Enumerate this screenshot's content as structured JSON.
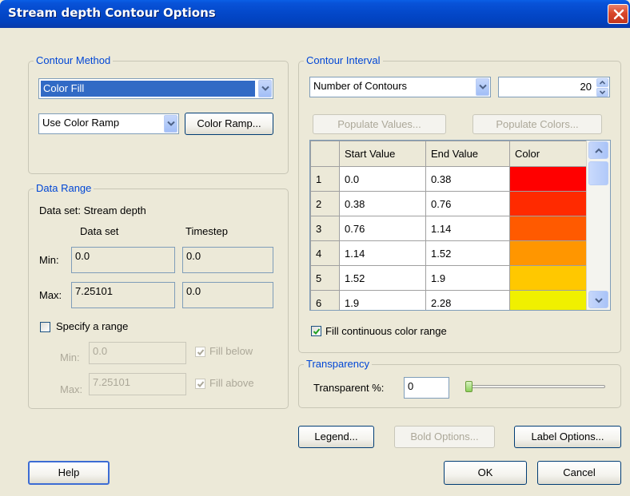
{
  "window": {
    "title": "Stream depth Contour Options"
  },
  "contour_method": {
    "legend": "Contour Method",
    "method_value": "Color Fill",
    "ramp_value": "Use Color Ramp",
    "color_ramp_button": "Color Ramp..."
  },
  "data_range": {
    "legend": "Data Range",
    "data_set_label": "Data set:  Stream depth",
    "col_dataset": "Data set",
    "col_timestep": "Timestep",
    "min_label": "Min:",
    "max_label": "Max:",
    "min_dataset": "0.0",
    "min_timestep": "0.0",
    "max_dataset": "7.25101",
    "max_timestep": "0.0",
    "specify_range_label": "Specify a range",
    "specify_range_checked": false,
    "range_min_label": "Min:",
    "range_max_label": "Max:",
    "range_min_value": "0.0",
    "range_max_value": "7.25101",
    "fill_below_label": "Fill below",
    "fill_above_label": "Fill above"
  },
  "contour_interval": {
    "legend": "Contour Interval",
    "mode_value": "Number of Contours",
    "count_value": "20",
    "populate_values_button": "Populate Values...",
    "populate_colors_button": "Populate Colors...",
    "columns": [
      "",
      "Start Value",
      "End Value",
      "Color"
    ],
    "rows": [
      {
        "index": "1",
        "start": "0.0",
        "end": "0.38",
        "color": "#ff0000"
      },
      {
        "index": "2",
        "start": "0.38",
        "end": "0.76",
        "color": "#ff2a00"
      },
      {
        "index": "3",
        "start": "0.76",
        "end": "1.14",
        "color": "#ff5a00"
      },
      {
        "index": "4",
        "start": "1.14",
        "end": "1.52",
        "color": "#ff9600"
      },
      {
        "index": "5",
        "start": "1.52",
        "end": "1.9",
        "color": "#ffc800"
      },
      {
        "index": "6",
        "start": "1.9",
        "end": "2.28",
        "color": "#f0f000"
      }
    ],
    "fill_continuous_label": "Fill continuous color range",
    "fill_continuous_checked": true
  },
  "transparency": {
    "legend": "Transparency",
    "label": "Transparent %:",
    "value": "0",
    "slider_fraction": 0
  },
  "buttons": {
    "legend": "Legend...",
    "bold_options": "Bold Options...",
    "label_options": "Label Options...",
    "help": "Help",
    "ok": "OK",
    "cancel": "Cancel"
  }
}
